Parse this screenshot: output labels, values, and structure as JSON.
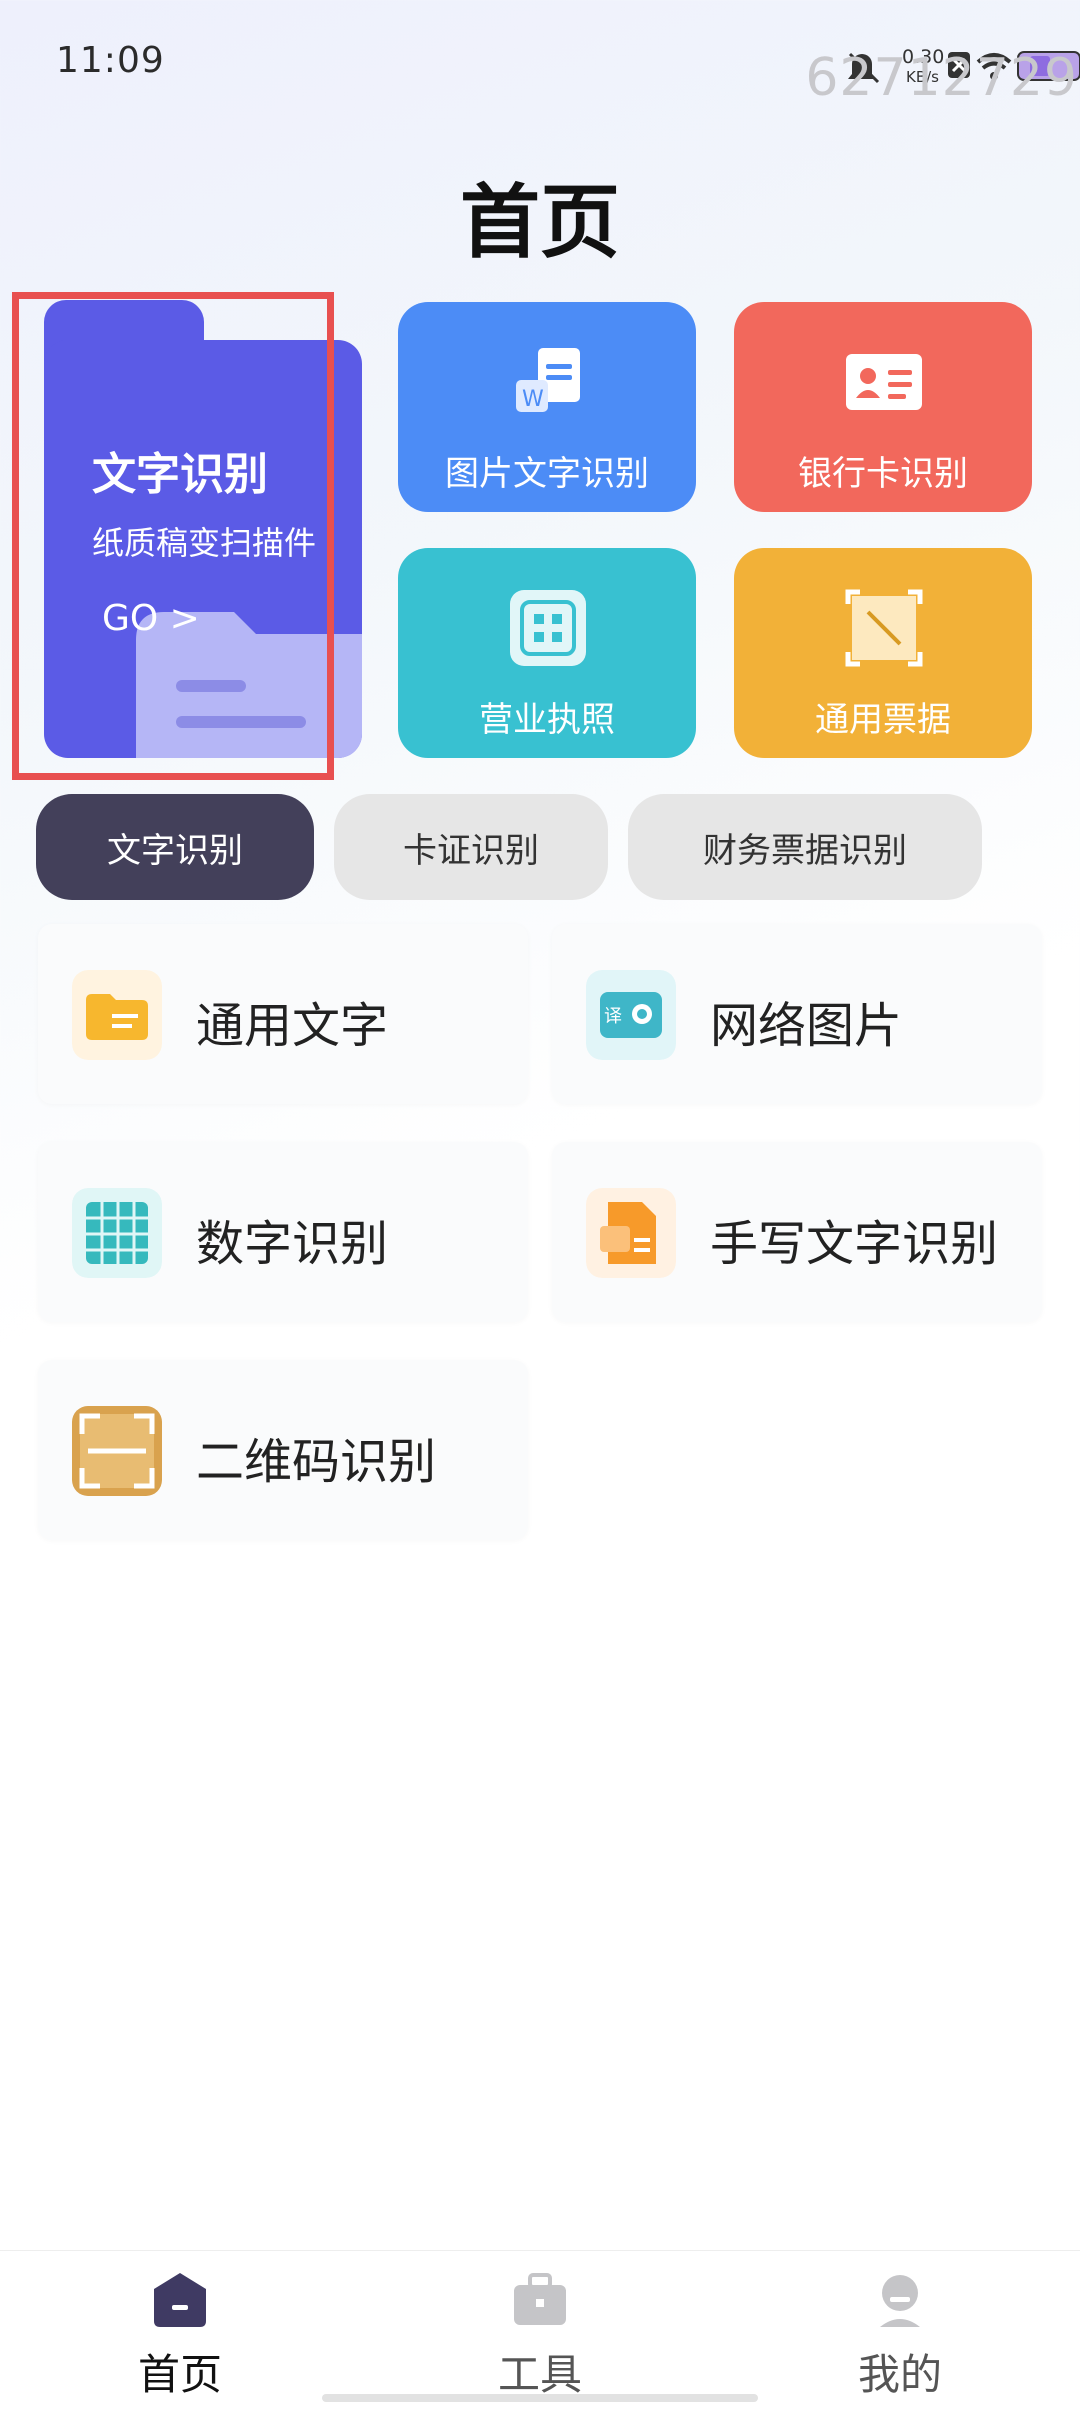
{
  "status_bar": {
    "time": "11:09",
    "net_speed_value": "0.30",
    "net_speed_unit": "KB/s",
    "watermark": "62712729"
  },
  "page_title": "首页",
  "hero": {
    "title": "文字识别",
    "subtitle": "纸质稿变扫描件",
    "go": "GO >"
  },
  "tiles": [
    {
      "label": "图片文字识别",
      "icon": "word-document-icon",
      "color": "#4c8cf6"
    },
    {
      "label": "银行卡识别",
      "icon": "id-card-icon",
      "color": "#f2685c"
    },
    {
      "label": "营业执照",
      "icon": "scan-frame-icon",
      "color": "#38c1d1"
    },
    {
      "label": "通用票据",
      "icon": "receipt-frame-icon",
      "color": "#f2b138"
    }
  ],
  "tabs": [
    {
      "label": "文字识别",
      "active": true
    },
    {
      "label": "卡证识别",
      "active": false
    },
    {
      "label": "财务票据识别",
      "active": false
    }
  ],
  "items": [
    {
      "label": "通用文字",
      "icon": "yellow-folder-icon"
    },
    {
      "label": "网络图片",
      "icon": "translate-camera-icon"
    },
    {
      "label": "数字识别",
      "icon": "grid-digits-icon"
    },
    {
      "label": "手写文字识别",
      "icon": "handwriting-doc-icon"
    },
    {
      "label": "二维码识别",
      "icon": "qr-scan-icon"
    }
  ],
  "bottom_nav": [
    {
      "label": "首页",
      "active": true
    },
    {
      "label": "工具",
      "active": false
    },
    {
      "label": "我的",
      "active": false
    }
  ]
}
